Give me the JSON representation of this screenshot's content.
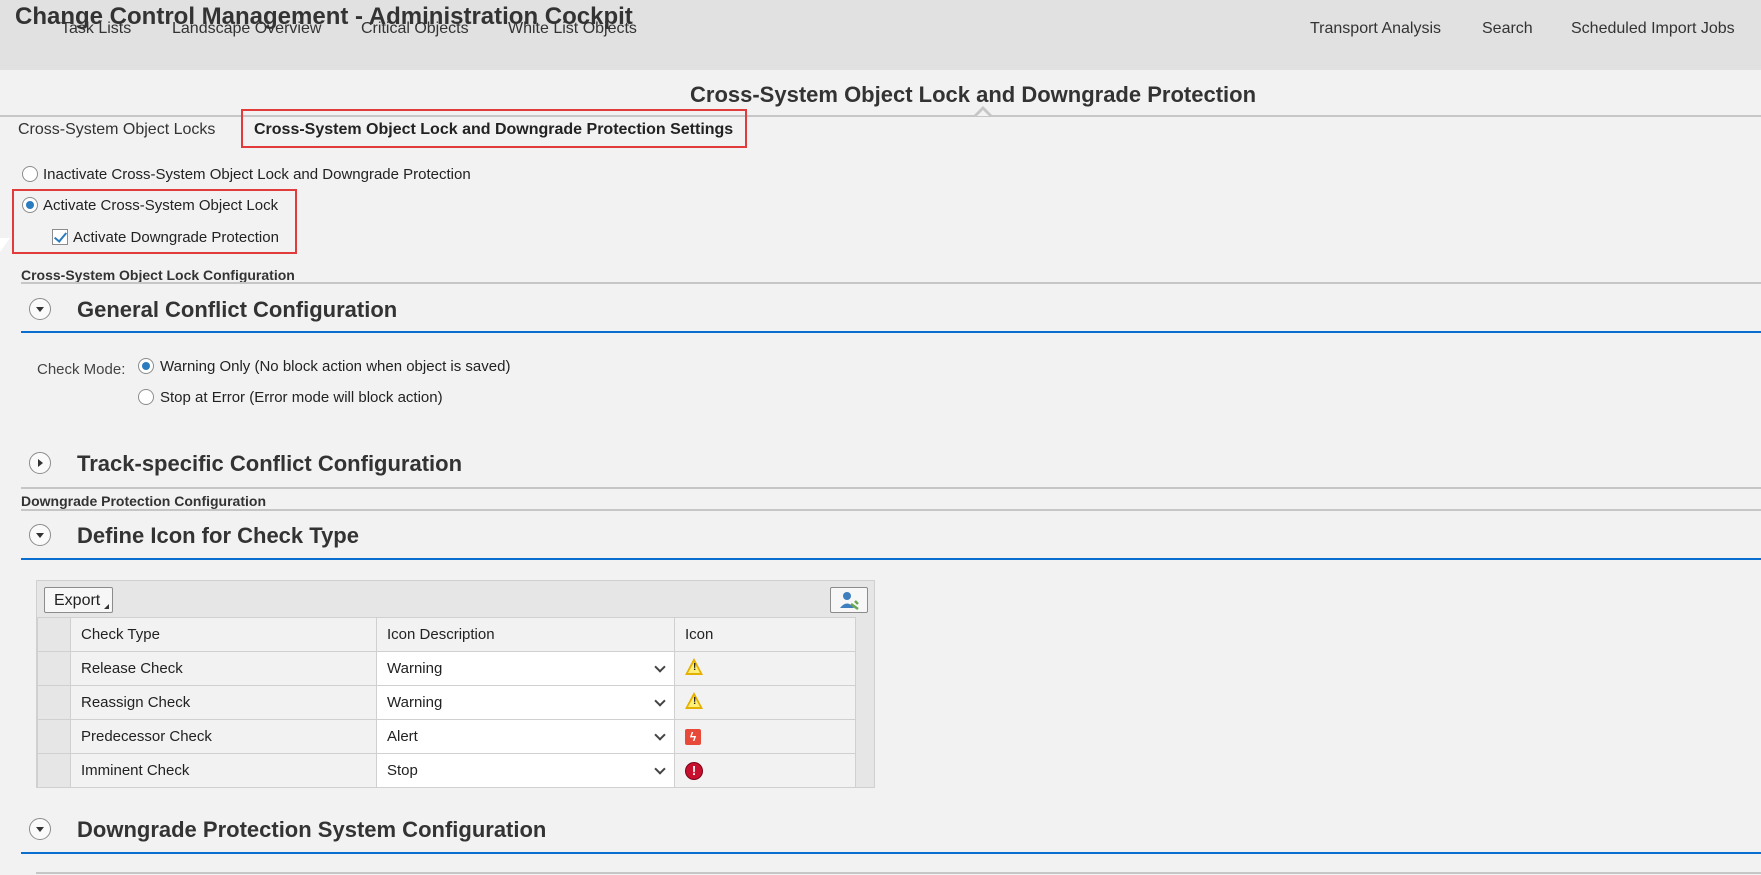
{
  "app": {
    "title": "Change Control Management - Administration Cockpit"
  },
  "main_tabs": [
    {
      "label": "Task Lists"
    },
    {
      "label": "Landscape Overview"
    },
    {
      "label": "Critical Objects"
    },
    {
      "label": "White List Objects"
    },
    {
      "label": "Cross-System Object Lock and Downgrade Protection",
      "active": true
    },
    {
      "label": "Transport Analysis"
    },
    {
      "label": "Search"
    },
    {
      "label": "Scheduled Import Jobs"
    }
  ],
  "sub_tabs": [
    {
      "label": "Cross-System Object Locks"
    },
    {
      "label": "Cross-System Object Lock and Downgrade Protection Settings",
      "active": true
    }
  ],
  "lock_options": {
    "inactivate": {
      "label": "Inactivate Cross-System Object Lock and Downgrade Protection",
      "selected": false
    },
    "activate": {
      "label": "Activate Cross-System Object Lock",
      "selected": true
    },
    "downgrade": {
      "label": "Activate Downgrade Protection",
      "checked": true
    }
  },
  "sections": {
    "lock_config": "Cross-System Object Lock Configuration",
    "downgrade_config": "Downgrade Protection Configuration"
  },
  "panels": {
    "general": {
      "title": "General Conflict Configuration",
      "expanded": true,
      "check_mode_label": "Check Mode:",
      "options": [
        {
          "label": "Warning Only (No block action when object is saved)",
          "selected": true
        },
        {
          "label": "Stop at Error (Error mode will block action)",
          "selected": false
        }
      ]
    },
    "track": {
      "title": "Track-specific Conflict Configuration",
      "expanded": false
    },
    "icon": {
      "title": "Define Icon for Check Type",
      "expanded": true
    },
    "system": {
      "title": "Downgrade Protection System Configuration",
      "expanded": true
    }
  },
  "icon_table": {
    "export_label": "Export",
    "settings_icon": "personalize-icon",
    "columns": [
      "Check Type",
      "Icon Description",
      "Icon"
    ],
    "rows": [
      {
        "check_type": "Release Check",
        "description": "Warning",
        "icon": "warning-icon"
      },
      {
        "check_type": "Reassign Check",
        "description": "Warning",
        "icon": "warning-icon"
      },
      {
        "check_type": "Predecessor Check",
        "description": "Alert",
        "icon": "alert-icon"
      },
      {
        "check_type": "Imminent Check",
        "description": "Stop",
        "icon": "stop-icon"
      }
    ]
  },
  "colors": {
    "accent": "#0a6ed1",
    "highlight": "#e23b3b",
    "radio_dot": "#2b7cbf"
  }
}
